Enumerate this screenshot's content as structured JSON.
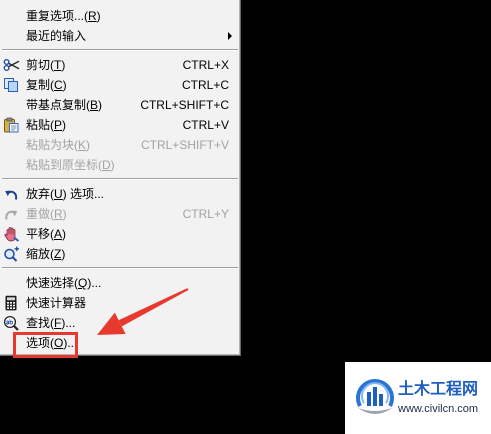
{
  "theme": {
    "screen_bg": "#000000",
    "menu_bg": "#f2f2f2",
    "disabled_text": "#a3a3a3",
    "annotation_red": "#e8392e",
    "brand_blue": "#1f5fbf"
  },
  "menu": {
    "sections": [
      [
        {
          "pre": "重复选项...(",
          "key": "R",
          "post": ")"
        },
        {
          "pre": "最近的输入",
          "submenu": true,
          "submenu_icon": "chevron-right-icon"
        }
      ],
      [
        {
          "icon": "scissors-icon",
          "pre": "剪切(",
          "key": "T",
          "post": ")",
          "shortcut": "CTRL+X"
        },
        {
          "icon": "copy-icon",
          "pre": "复制(",
          "key": "C",
          "post": ")",
          "shortcut": "CTRL+C"
        },
        {
          "pre": "带基点复制(",
          "key": "B",
          "post": ")",
          "shortcut": "CTRL+SHIFT+C"
        },
        {
          "icon": "paste-icon",
          "pre": "粘贴(",
          "key": "P",
          "post": ")",
          "shortcut": "CTRL+V"
        },
        {
          "pre": "粘贴为块(",
          "key": "K",
          "post": ")",
          "shortcut": "CTRL+SHIFT+V",
          "disabled": true
        },
        {
          "pre": "粘贴到原坐标(",
          "key": "D",
          "post": ")",
          "disabled": true
        }
      ],
      [
        {
          "icon": "undo-icon",
          "pre": "放弃(",
          "key": "U",
          "post": ") 选项..."
        },
        {
          "icon": "redo-icon",
          "pre": "重做(",
          "key": "R",
          "post": ")",
          "shortcut": "CTRL+Y",
          "disabled": true
        },
        {
          "icon": "pan-hand-icon",
          "pre": "平移(",
          "key": "A",
          "post": ")"
        },
        {
          "icon": "zoom-icon",
          "pre": "缩放(",
          "key": "Z",
          "post": ")"
        }
      ],
      [
        {
          "pre": "快速选择(",
          "key": "Q",
          "post": ")..."
        },
        {
          "icon": "calculator-icon",
          "pre": "快速计算器"
        },
        {
          "icon": "find-icon",
          "pre": "查找(",
          "key": "F",
          "post": ")..."
        },
        {
          "pre": "选项(",
          "key": "O",
          "post": ")...",
          "highlighted": true
        }
      ]
    ]
  },
  "watermark": {
    "logo_icon": "civil-engineering-logo-icon",
    "name": "土木工程网",
    "url": "www.civilcn.com"
  }
}
